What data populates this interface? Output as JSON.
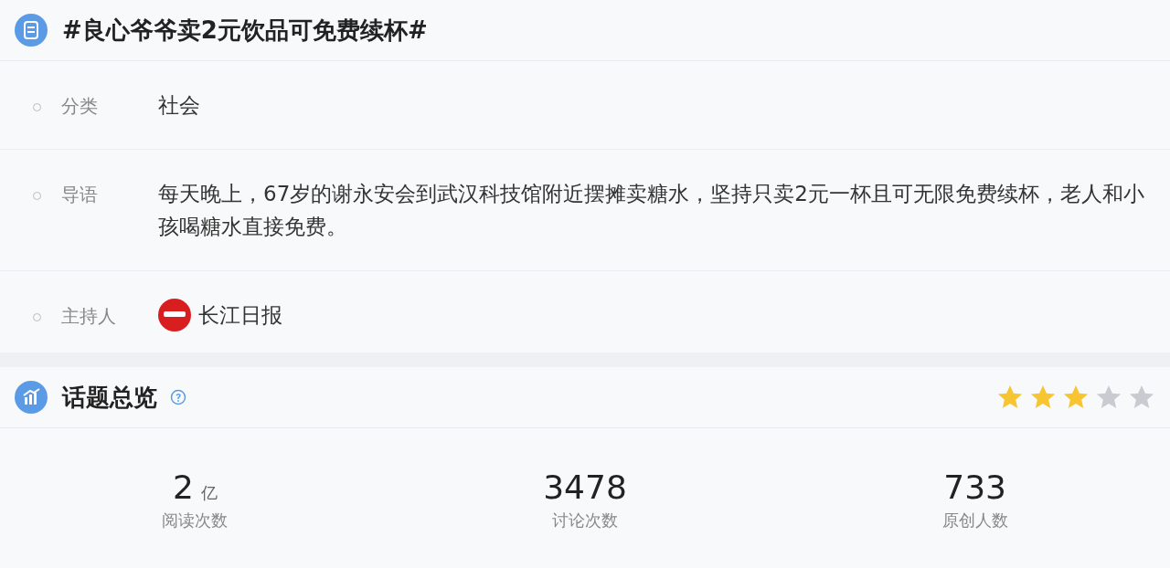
{
  "topic": {
    "title": "#良心爷爷卖2元饮品可免费续杯#",
    "rows": [
      {
        "kind": "text",
        "label": "分类",
        "value": "社会"
      },
      {
        "kind": "text",
        "label": "导语",
        "value": "每天晚上，67岁的谢永安会到武汉科技馆附近摆摊卖糖水，坚持只卖2元一杯且可无限免费续杯，老人和小孩喝糖水直接免费。"
      },
      {
        "kind": "host",
        "label": "主持人",
        "value": "长江日报"
      }
    ]
  },
  "overview": {
    "title": "话题总览",
    "stars": 3,
    "stats": [
      {
        "value": "2",
        "unit": "亿",
        "label": "阅读次数"
      },
      {
        "value": "3478",
        "label": "讨论次数"
      },
      {
        "value": "733",
        "label": "原创人数"
      }
    ]
  }
}
